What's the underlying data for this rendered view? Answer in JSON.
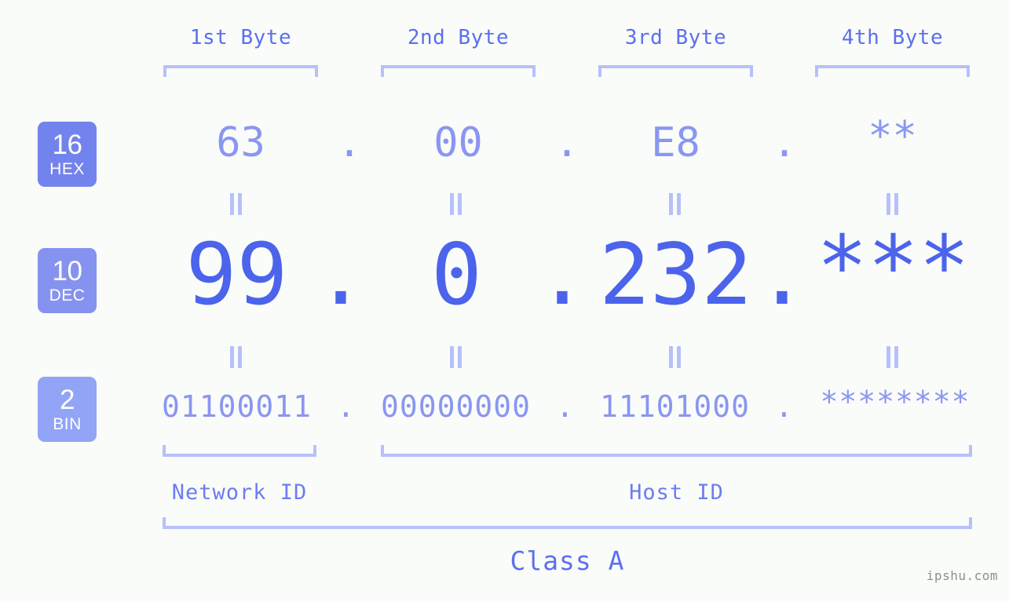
{
  "page": {
    "background_color": "#fafcf9",
    "accent_color": "#5c6ff0",
    "accent_light_color": "#8a96f2",
    "bracket_color": "#b6c0fb",
    "watermark": "ipshu.com"
  },
  "byte_headers": [
    {
      "label": "1st Byte"
    },
    {
      "label": "2nd Byte"
    },
    {
      "label": "3rd Byte"
    },
    {
      "label": "4th Byte"
    }
  ],
  "bases": [
    {
      "num": "16",
      "name": "HEX",
      "color": "#7383ed"
    },
    {
      "num": "10",
      "name": "DEC",
      "color": "#8692f0"
    },
    {
      "num": "2",
      "name": "BIN",
      "color": "#92a4f5"
    }
  ],
  "rows": {
    "hex": {
      "base_num": "16",
      "base_name": "HEX",
      "values": [
        "63",
        "00",
        "E8",
        "**"
      ],
      "separators": [
        ".",
        ".",
        "."
      ]
    },
    "dec": {
      "base_num": "10",
      "base_name": "DEC",
      "values": [
        "99",
        "0",
        "232",
        "***"
      ],
      "separators": [
        ".",
        ".",
        "."
      ]
    },
    "bin": {
      "base_num": "2",
      "base_name": "BIN",
      "values": [
        "01100011",
        "00000000",
        "11101000",
        "********"
      ],
      "separators": [
        ".",
        ".",
        "."
      ]
    }
  },
  "equals_connectors": {
    "symbol": "=",
    "count_per_row": 4,
    "rows": 2
  },
  "id_labels": [
    {
      "label": "Network ID"
    },
    {
      "label": "Host ID"
    }
  ],
  "class_label": {
    "label": "Class A"
  }
}
